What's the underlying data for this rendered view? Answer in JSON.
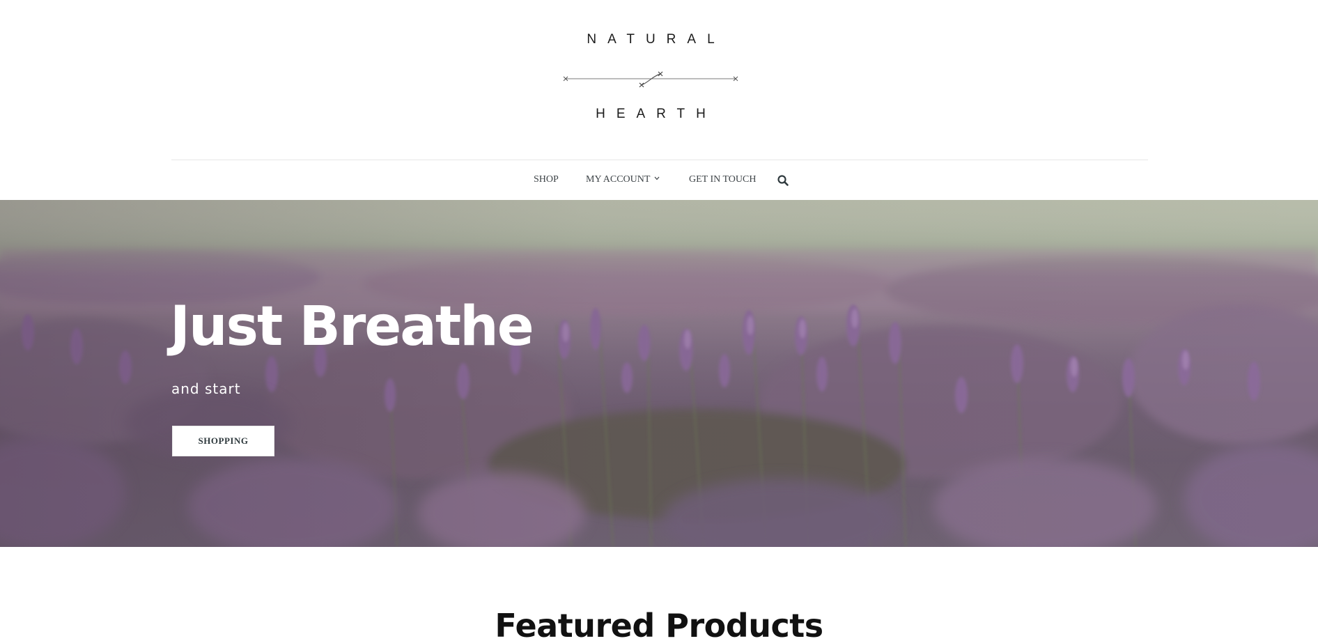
{
  "brand": {
    "line1": "NATURAL",
    "line2": "HEARTH"
  },
  "nav": {
    "shop": "SHOP",
    "my_account": "MY ACCOUNT",
    "get_in_touch": "GET IN TOUCH",
    "search_icon": "search-icon",
    "chevron_icon": "chevron-down-icon"
  },
  "hero": {
    "title": "Just Breathe",
    "subtitle": "and start",
    "button": "SHOPPING"
  },
  "featured": {
    "title": "Featured Products"
  },
  "colors": {
    "nav_text": "#3d4347",
    "divider": "#e6e6e6",
    "hero_text": "#ffffff",
    "lavender": "#8d6c96"
  }
}
